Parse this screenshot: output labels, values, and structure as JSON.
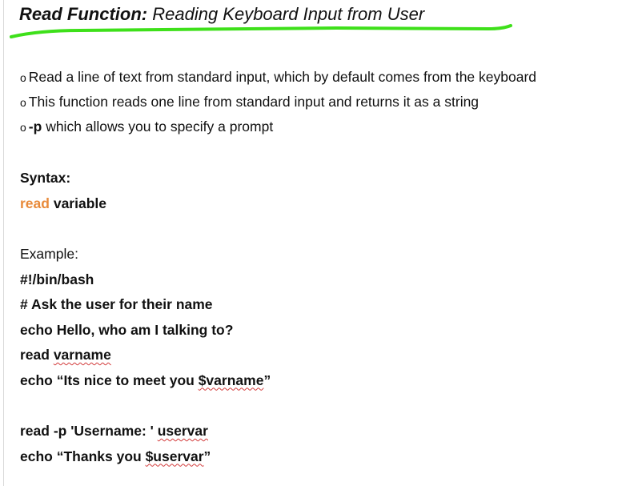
{
  "title": {
    "bold_part": "Read Function:",
    "rest": " Reading Keyboard Input from User"
  },
  "colors": {
    "underline": "#3ee01a",
    "keyword": "#e88a3a",
    "spellcheck": "#d23b3b"
  },
  "bullets": [
    {
      "marker": "o",
      "bold": "",
      "text": "Read a line of text from standard input, which by default comes from the keyboard"
    },
    {
      "marker": "o",
      "bold": "",
      "text": "This function reads one line from standard input and returns it as a string"
    },
    {
      "marker": "o",
      "bold": "-p",
      "text": " which allows you to specify a prompt"
    }
  ],
  "syntax": {
    "heading": "Syntax:",
    "keyword": "read",
    "rest": " variable"
  },
  "example": {
    "heading": "Example:",
    "shebang": "#!/bin/bash",
    "comment": "# Ask the user for their name",
    "echo1": "echo Hello, who am I talking to?",
    "read1_prefix": "read ",
    "read1_var": "varname",
    "echo2_prefix": "echo “Its nice to meet you ",
    "echo2_var": "$varname",
    "echo2_suffix": "”",
    "read2_prefix": "read -p 'Username: ' ",
    "read2_var": "uservar",
    "echo3_prefix": "echo “Thanks you ",
    "echo3_var": "$uservar",
    "echo3_suffix": "”"
  }
}
